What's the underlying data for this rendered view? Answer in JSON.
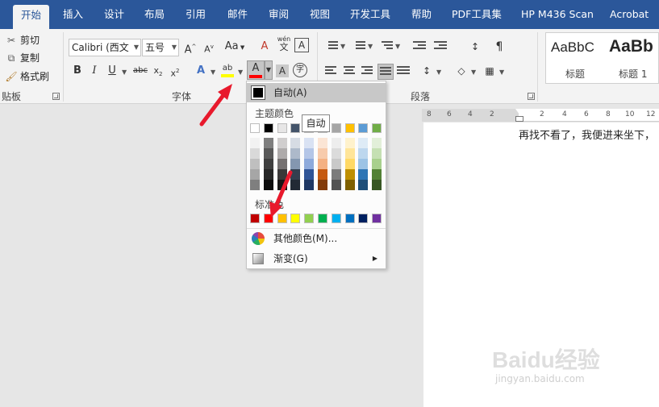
{
  "tabs": [
    {
      "label": "开始",
      "active": true
    },
    {
      "label": "插入"
    },
    {
      "label": "设计"
    },
    {
      "label": "布局"
    },
    {
      "label": "引用"
    },
    {
      "label": "邮件"
    },
    {
      "label": "审阅"
    },
    {
      "label": "视图"
    },
    {
      "label": "开发工具"
    },
    {
      "label": "帮助"
    },
    {
      "label": "PDF工具集"
    },
    {
      "label": "HP M436 Scan"
    },
    {
      "label": "Acrobat"
    }
  ],
  "clipboard": {
    "cut": "剪切",
    "copy": "复制",
    "format_painter": "格式刷",
    "group_label": "贴板"
  },
  "font": {
    "font_name": "Calibri (西文",
    "font_size": "五号",
    "group_label": "字体",
    "pinyin_glyph": "wén",
    "enclose_glyph": "字"
  },
  "paragraph": {
    "group_label": "段落"
  },
  "styles": [
    {
      "sample": "AaBbC",
      "name": "标题"
    },
    {
      "sample": "AaBb",
      "name": "标题 1"
    }
  ],
  "color_menu": {
    "auto_label": "自动(A)",
    "theme_colors_label": "主题颜色",
    "standard_colors_label": "标准色",
    "more_colors_label": "其他颜色(M)...",
    "gradient_label": "渐变(G)",
    "tooltip": "自动",
    "theme_top": [
      "#ffffff",
      "#000000",
      "#e7e6e6",
      "#44546a",
      "#4472c4",
      "#ed7d31",
      "#a5a5a5",
      "#ffc000",
      "#5b9bd5",
      "#70ad47"
    ],
    "theme_shades": [
      [
        "#f2f2f2",
        "#d9d9d9",
        "#bfbfbf",
        "#a6a6a6",
        "#7f7f7f"
      ],
      [
        "#7f7f7f",
        "#595959",
        "#3f3f3f",
        "#262626",
        "#0d0d0d"
      ],
      [
        "#d0cece",
        "#aeabab",
        "#757171",
        "#3a3838",
        "#171616"
      ],
      [
        "#d6dce4",
        "#adb9ca",
        "#8497b0",
        "#333f4f",
        "#222a35"
      ],
      [
        "#d9e2f3",
        "#b4c6e7",
        "#8eaadb",
        "#2f5496",
        "#1f3864"
      ],
      [
        "#fbe5d5",
        "#f7cbac",
        "#f4b183",
        "#c55a11",
        "#833c0b"
      ],
      [
        "#ededed",
        "#dbdbdb",
        "#c9c9c9",
        "#7b7b7b",
        "#525252"
      ],
      [
        "#fff2cc",
        "#ffe599",
        "#ffd966",
        "#bf8f00",
        "#7f6000"
      ],
      [
        "#deebf6",
        "#bdd7ee",
        "#9cc3e5",
        "#2e75b5",
        "#1e4e79"
      ],
      [
        "#e2efd9",
        "#c5e0b3",
        "#a8d08d",
        "#538135",
        "#375623"
      ]
    ],
    "standard": [
      "#c00000",
      "#ff0000",
      "#ffc000",
      "#ffff00",
      "#92d050",
      "#00b050",
      "#00b0f0",
      "#0070c0",
      "#002060",
      "#7030a0"
    ]
  },
  "ruler": {
    "numbers": [
      "8",
      "6",
      "4",
      "2",
      "2",
      "4",
      "6",
      "8",
      "10",
      "12"
    ]
  },
  "document": {
    "text": "再找不看了，我便进来坐下，"
  },
  "watermark": {
    "brand": "Baidu经验",
    "url": "jingyan.baidu.com"
  },
  "colors": {
    "accent": "#2b579a",
    "arrow": "#e8192c",
    "font_color_bar": "#ff0000",
    "highlight_bar": "#ffff00"
  }
}
